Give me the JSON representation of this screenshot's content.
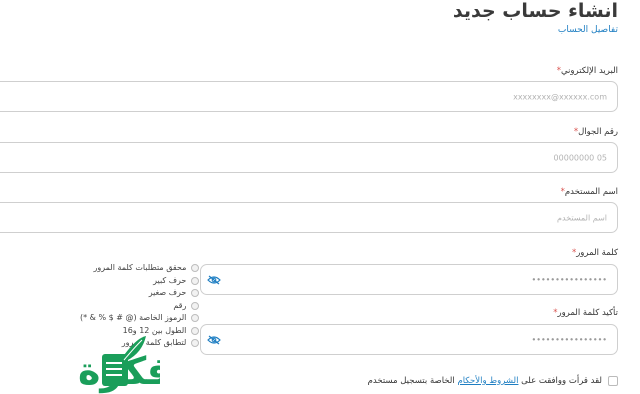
{
  "header": {
    "title": "انشاء حساب جديد",
    "section_link": "تفاصيل الحساب"
  },
  "fields": {
    "email": {
      "label": "البريد الإلكتروني",
      "required_mark": "*",
      "placeholder": "xxxxxxxx@xxxxxx.com"
    },
    "phone": {
      "label": "رقم الجوال",
      "required_mark": "*",
      "placeholder": "05 00000000"
    },
    "username": {
      "label": "اسم المستخدم",
      "required_mark": "*",
      "placeholder": "اسم المستخدم"
    },
    "password": {
      "label": "كلمة المرور",
      "required_mark": "*",
      "placeholder": "••••••••••••••••"
    },
    "confirm_password": {
      "label": "تأكيد كلمة المرور",
      "required_mark": "*",
      "placeholder": "••••••••••••••••"
    }
  },
  "password_requirements": [
    "محقق متطلبات كلمة المرور",
    "حرف كبير",
    "حرف صغير",
    "رقم",
    "الرموز الخاصة (@ # $ % & *)",
    "الطول بين 12 و16",
    "لتطابق كلمة المرور"
  ],
  "terms": {
    "prefix": "لقد قرأت ووافقت على",
    "link": "الشروط والأحكام",
    "suffix": "الخاصة بتسجيل مستخدم"
  },
  "watermark": {
    "text": "فكرة"
  },
  "colors": {
    "link": "#1e7ec2",
    "logo": "#1a9e5a",
    "required": "#d9534f"
  }
}
